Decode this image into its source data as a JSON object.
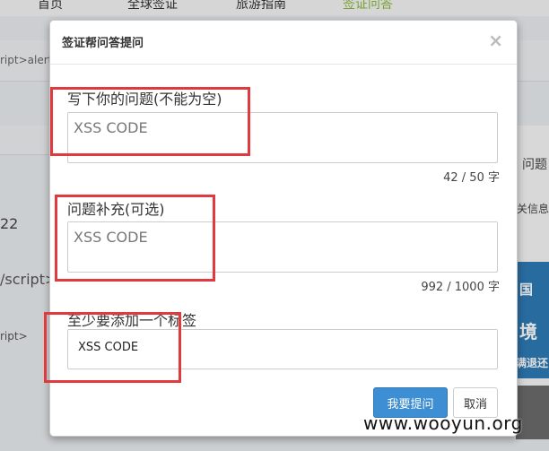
{
  "background": {
    "nav": [
      "首页",
      "全球签证",
      "旅游指南",
      "签证问答"
    ],
    "left_snippets": [
      "ript>alert(",
      "22",
      "/script>",
      "ript>"
    ],
    "right_snippets": [
      "问题",
      "关信息"
    ],
    "ad_text": [
      "国",
      "境",
      "满退还"
    ]
  },
  "modal": {
    "title": "签证帮问答提问",
    "close_label": "×",
    "question": {
      "label": "写下你的问题(不能为空)",
      "value": "XSS CODE",
      "counter": "42 / 50 字"
    },
    "supplement": {
      "label": "问题补充(可选)",
      "value": "XSS CODE",
      "counter": "992 / 1000 字"
    },
    "tags": {
      "label": "至少要添加一个标签",
      "value": "XSS CODE"
    },
    "submit_label": "我要提问",
    "cancel_label": "取消"
  },
  "watermark": "www.wooyun.org",
  "colors": {
    "primary": "#3d8ed3",
    "highlight": "#e0393e"
  }
}
